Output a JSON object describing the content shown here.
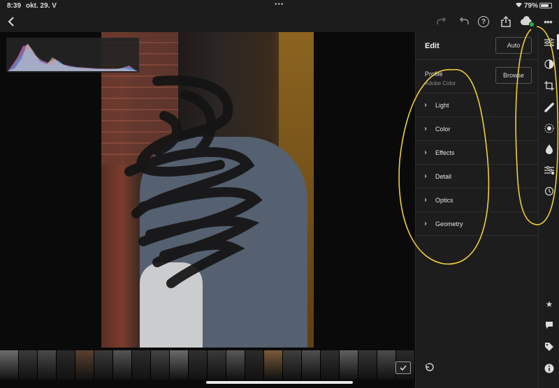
{
  "status_bar": {
    "time": "8:39",
    "date": "okt. 29. V",
    "battery": "79%",
    "battery_fraction": 0.79
  },
  "toolbar": {
    "icons": [
      "back-icon",
      "redo-icon",
      "undo-icon",
      "help-icon",
      "share-icon",
      "cloud-sync-icon",
      "more-icon"
    ],
    "help_label": "?",
    "more_label": "•••"
  },
  "edit_panel": {
    "title": "Edit",
    "auto_label": "Auto",
    "profile_label": "Profile",
    "profile_value": "Adobe Color",
    "browse_label": "Browse",
    "sections": [
      {
        "label": "Light"
      },
      {
        "label": "Color"
      },
      {
        "label": "Effects"
      },
      {
        "label": "Detail"
      },
      {
        "label": "Optics"
      },
      {
        "label": "Geometry"
      }
    ]
  },
  "tool_rail": {
    "icons": [
      "edit-sliders-icon",
      "masking-icon",
      "crop-icon",
      "healing-icon",
      "selective-icon",
      "brush-icon",
      "presets-icon",
      "versions-icon",
      "star-icon",
      "comment-icon",
      "tag-icon",
      "info-icon"
    ]
  },
  "colors": {
    "annotation": "#f2cf3a",
    "cloud_status": "#25b34b",
    "panel_bg": "#1d1d1d"
  }
}
